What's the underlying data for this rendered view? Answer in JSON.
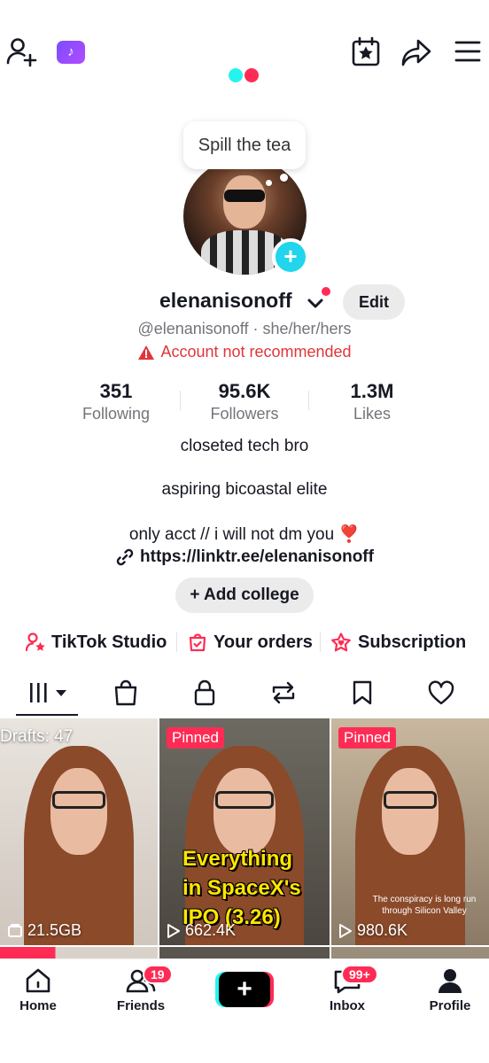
{
  "top_bar": {
    "badge_glyph": "♪",
    "icons": [
      "add-user-icon",
      "tiktok-badge-icon",
      "calendar-star-icon",
      "share-icon",
      "menu-icon"
    ]
  },
  "profile": {
    "status_bubble": "Spill the tea",
    "username": "elenanisonoff",
    "edit_label": "Edit",
    "handle_line": "@elenanisonoff · she/her/hers",
    "warning": "Account not recommended",
    "stats": [
      {
        "value": "351",
        "label": "Following"
      },
      {
        "value": "95.6K",
        "label": "Followers"
      },
      {
        "value": "1.3M",
        "label": "Likes"
      }
    ],
    "bio": [
      "closeted tech bro",
      "aspiring bicoastal elite",
      "only acct // i will not dm you ❣️"
    ],
    "link": "https://linktr.ee/elenanisonoff",
    "add_college": "+ Add college"
  },
  "quick_links": [
    {
      "label": "TikTok Studio",
      "icon": "studio-person-star-icon"
    },
    {
      "label": "Your orders",
      "icon": "bag-check-icon"
    },
    {
      "label": "Subscription",
      "icon": "star-heart-icon"
    }
  ],
  "tabs": [
    "videos-grid-icon",
    "shop-bag-icon",
    "lock-icon",
    "repost-icon",
    "bookmark-icon",
    "heart-icon"
  ],
  "grid": [
    {
      "tag": "Drafts: 47",
      "stat": "21.5GB",
      "stat_icon": "folder-icon"
    },
    {
      "tag": "Pinned",
      "stat": "662.4K",
      "stat_icon": "play-icon",
      "caption": "Everything in SpaceX's IPO (3.26)"
    },
    {
      "tag": "Pinned",
      "stat": "980.6K",
      "stat_icon": "play-icon",
      "caption": "The conspiracy is long run through Silicon Valley"
    }
  ],
  "nav": {
    "home": "Home",
    "friends": "Friends",
    "friends_badge": "19",
    "create_glyph": "+",
    "inbox": "Inbox",
    "inbox_badge": "99+",
    "profile": "Profile"
  },
  "colors": {
    "accent": "#fe2c55",
    "cyan": "#25f4ee",
    "warning": "#e0353a",
    "text": "#161823",
    "muted": "#73747a"
  }
}
